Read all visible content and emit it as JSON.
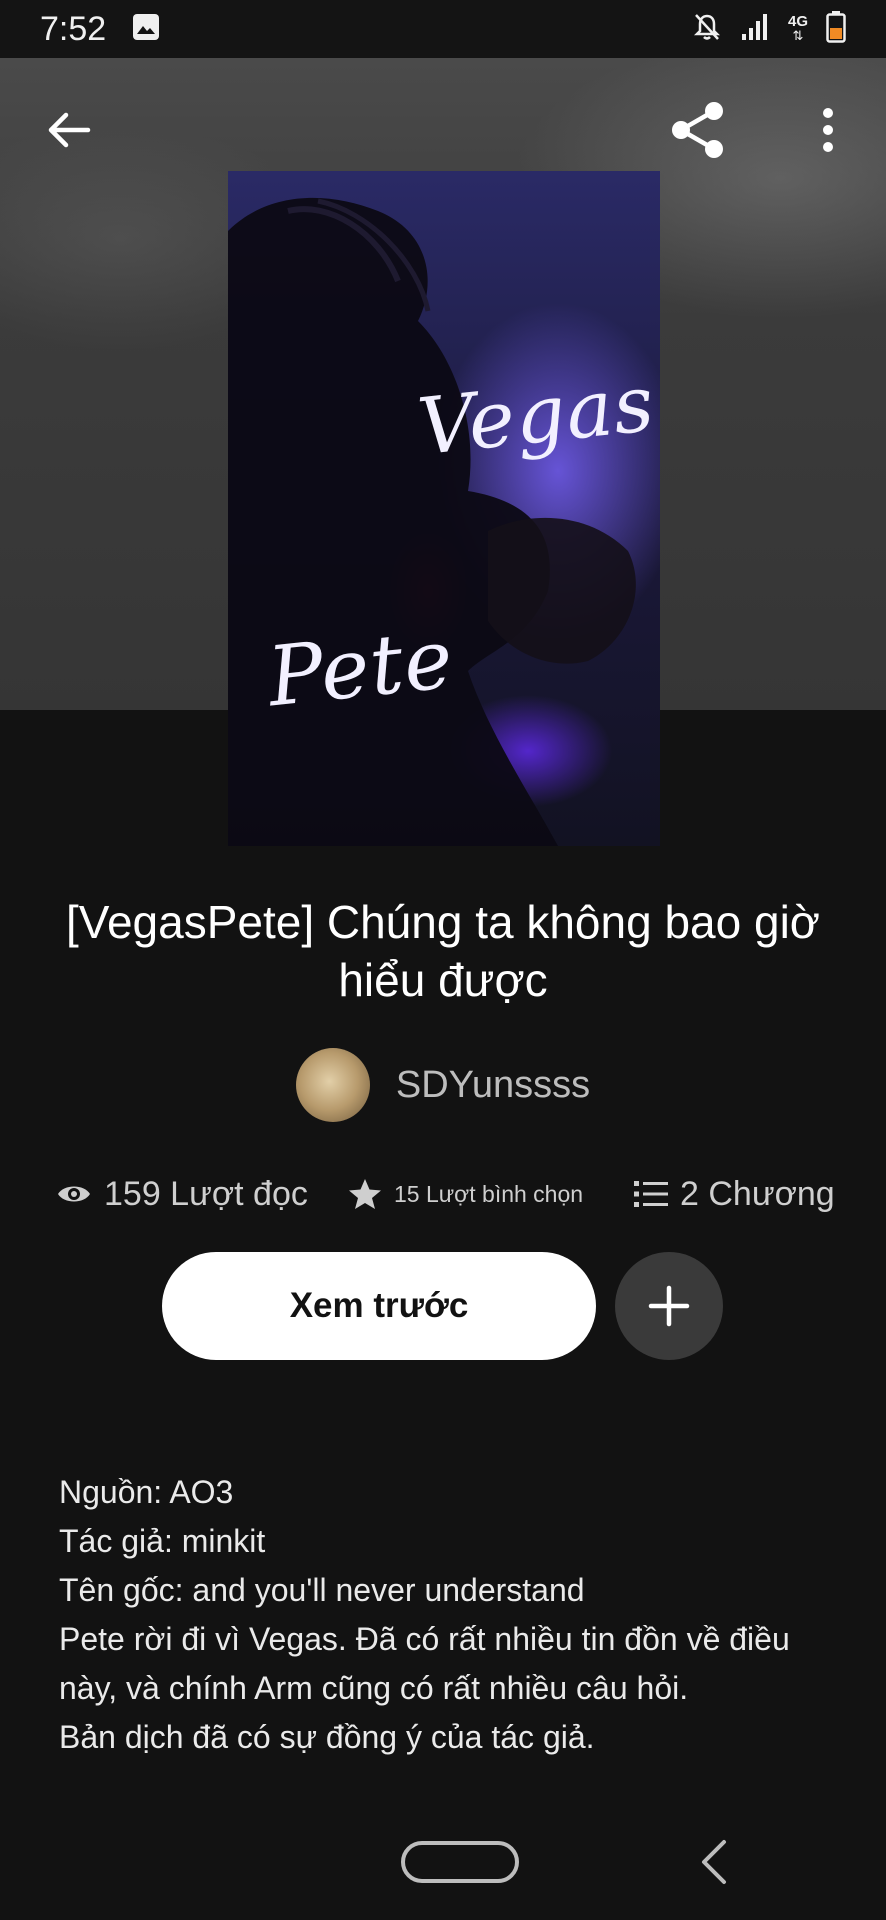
{
  "status_bar": {
    "time": "7:52",
    "network": "4G"
  },
  "cover": {
    "line1": "Vegas",
    "line2": "Pete"
  },
  "story": {
    "title": "[VegasPete] Chúng ta không bao giờ hiểu được",
    "author": "SDYunssss",
    "reads": "159 Lượt đọc",
    "votes": "15 Lượt bình chọn",
    "chapters": "2 Chương"
  },
  "actions": {
    "preview_label": "Xem trước"
  },
  "description": [
    "Nguồn: AO3",
    "Tác giả: minkit",
    "Tên gốc: and you'll never understand",
    "Pete rời đi vì Vegas. Đã có rất nhiều tin đồn về điều",
    "này, và chính Arm cũng có rất nhiều câu hỏi.",
    "Bản dịch đã có sự đồng ý của tác giả."
  ],
  "icons": [
    "image-icon",
    "bell-off-icon",
    "signal-icon",
    "network-4g-icon",
    "battery-icon",
    "back-arrow-icon",
    "share-icon",
    "more-options-icon",
    "eye-icon",
    "star-icon",
    "list-icon",
    "plus-icon",
    "home-pill-icon",
    "nav-back-icon"
  ],
  "colors": {
    "background": "#121212",
    "header": "#3b3b3b",
    "button": "#ffffff",
    "add_button": "#3a3a3a"
  }
}
